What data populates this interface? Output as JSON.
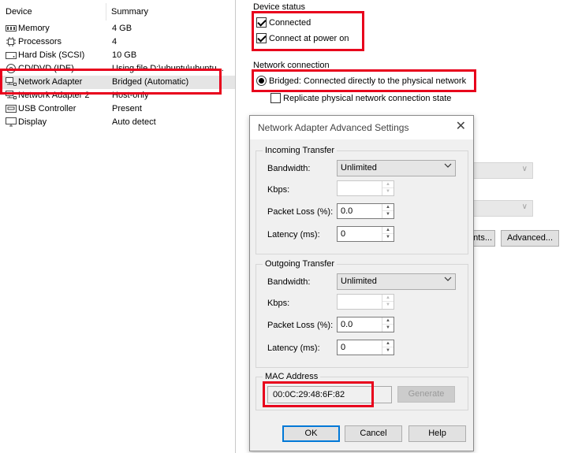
{
  "device_list": {
    "col_device": "Device",
    "col_summary": "Summary",
    "rows": [
      {
        "name": "Memory",
        "summary": "4 GB",
        "icon": "memory-icon"
      },
      {
        "name": "Processors",
        "summary": "4",
        "icon": "processor-icon"
      },
      {
        "name": "Hard Disk (SCSI)",
        "summary": "10 GB",
        "icon": "hard-disk-icon"
      },
      {
        "name": "CD/DVD (IDE)",
        "summary": "Using file D:\\ubuntu\\ubuntu...",
        "icon": "cd-dvd-icon"
      },
      {
        "name": "Network Adapter",
        "summary": "Bridged (Automatic)",
        "icon": "network-adapter-icon",
        "selected": true
      },
      {
        "name": "Network Adapter 2",
        "summary": "Host-only",
        "icon": "network-adapter-icon"
      },
      {
        "name": "USB Controller",
        "summary": "Present",
        "icon": "usb-controller-icon"
      },
      {
        "name": "Display",
        "summary": "Auto detect",
        "icon": "display-icon"
      }
    ]
  },
  "device_status": {
    "title": "Device status",
    "connected": {
      "label": "Connected",
      "checked": true
    },
    "connect_at_power_on": {
      "label": "Connect at power on",
      "checked": true
    }
  },
  "network_connection": {
    "title": "Network connection",
    "bridged": {
      "label": "Bridged: Connected directly to the physical network",
      "selected": true
    },
    "replicate": {
      "label": "Replicate physical network connection state",
      "checked": false
    }
  },
  "right_buttons": {
    "segments_label": "nts...",
    "advanced_label": "Advanced..."
  },
  "dialog": {
    "title": "Network Adapter Advanced Settings",
    "close_glyph": "✕",
    "incoming": {
      "legend": "Incoming Transfer",
      "bandwidth_label": "Bandwidth:",
      "bandwidth_value": "Unlimited",
      "kbps_label": "Kbps:",
      "kbps_value": "",
      "packet_loss_label": "Packet Loss (%):",
      "packet_loss_value": "0.0",
      "latency_label": "Latency (ms):",
      "latency_value": "0"
    },
    "outgoing": {
      "legend": "Outgoing Transfer",
      "bandwidth_label": "Bandwidth:",
      "bandwidth_value": "Unlimited",
      "kbps_label": "Kbps:",
      "kbps_value": "",
      "packet_loss_label": "Packet Loss (%):",
      "packet_loss_value": "0.0",
      "latency_label": "Latency (ms):",
      "latency_value": "0"
    },
    "mac": {
      "legend": "MAC Address",
      "value": "00:0C:29:48:6F:82",
      "generate_label": "Generate"
    },
    "ok_label": "OK",
    "cancel_label": "Cancel",
    "help_label": "Help"
  },
  "colors": {
    "highlight_box": "#e8001c",
    "selected_row": "#e5e5e5",
    "dialog_bg": "#f0f0f0",
    "primary_border": "#0078d7"
  }
}
